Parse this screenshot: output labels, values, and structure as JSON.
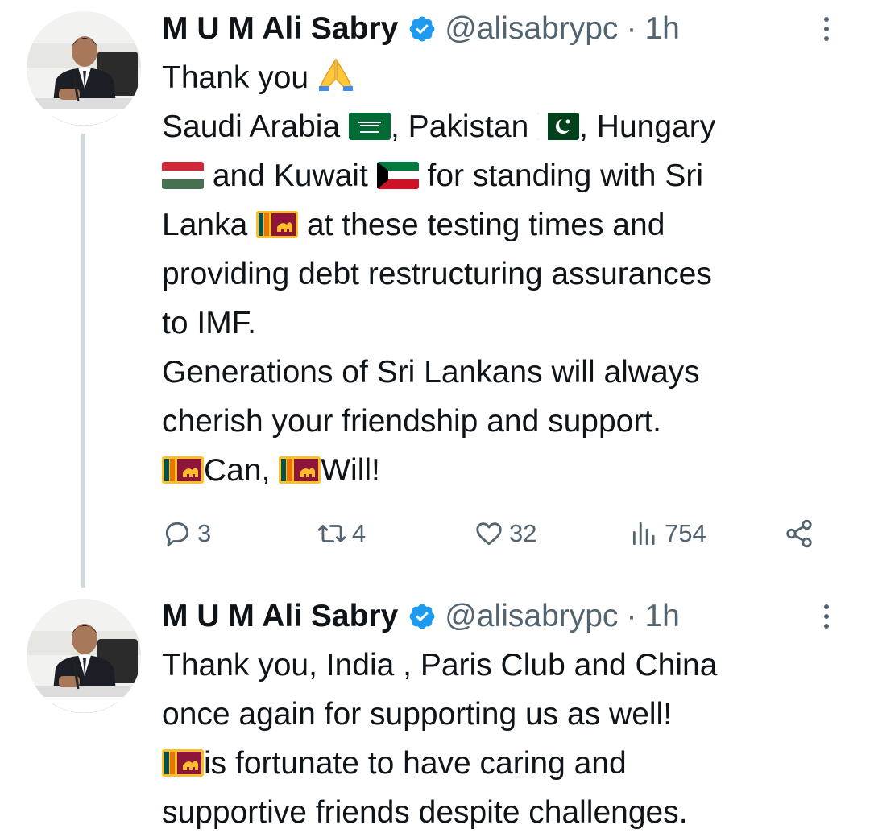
{
  "tweets": [
    {
      "author_name": "M U M Ali Sabry",
      "handle": "@alisabrypc",
      "separator": "·",
      "time": "1h",
      "text": {
        "l1": "Thank you",
        "l2a": "Saudi Arabia",
        "l2b": ", Pakistan",
        "l2c": ", Hungary",
        "l3a": "and  Kuwait",
        "l3b": "for standing with Sri",
        "l4a": "Lanka",
        "l4b": "at these testing times and",
        "l5": "providing debt restructuring assurances",
        "l6": "to IMF.",
        "l7": "Generations of Sri Lankans will always",
        "l8": "cherish your friendship and support.",
        "l9a": "Can,",
        "l9b": "Will!"
      },
      "stats": {
        "replies": "3",
        "retweets": "4",
        "likes": "32",
        "views": "754"
      },
      "icons": [
        "verified-badge-icon",
        "more-icon",
        "reply-icon",
        "retweet-icon",
        "like-icon",
        "views-icon",
        "share-icon",
        "folded-hands-emoji",
        "flag-saudi-arabia",
        "flag-pakistan",
        "flag-hungary",
        "flag-kuwait",
        "flag-sri-lanka"
      ]
    },
    {
      "author_name": "M U M Ali Sabry",
      "handle": "@alisabrypc",
      "separator": "·",
      "time": "1h",
      "text": {
        "l1": "Thank you, India , Paris Club and China",
        "l2": "once again for supporting us as well!",
        "l3": "is fortunate to have caring and",
        "l4": "supportive friends despite challenges."
      }
    }
  ],
  "colors": {
    "text": "#0f1419",
    "secondary": "#536471",
    "verified": "#1d9bf0",
    "thread_line": "#cfd9de"
  }
}
